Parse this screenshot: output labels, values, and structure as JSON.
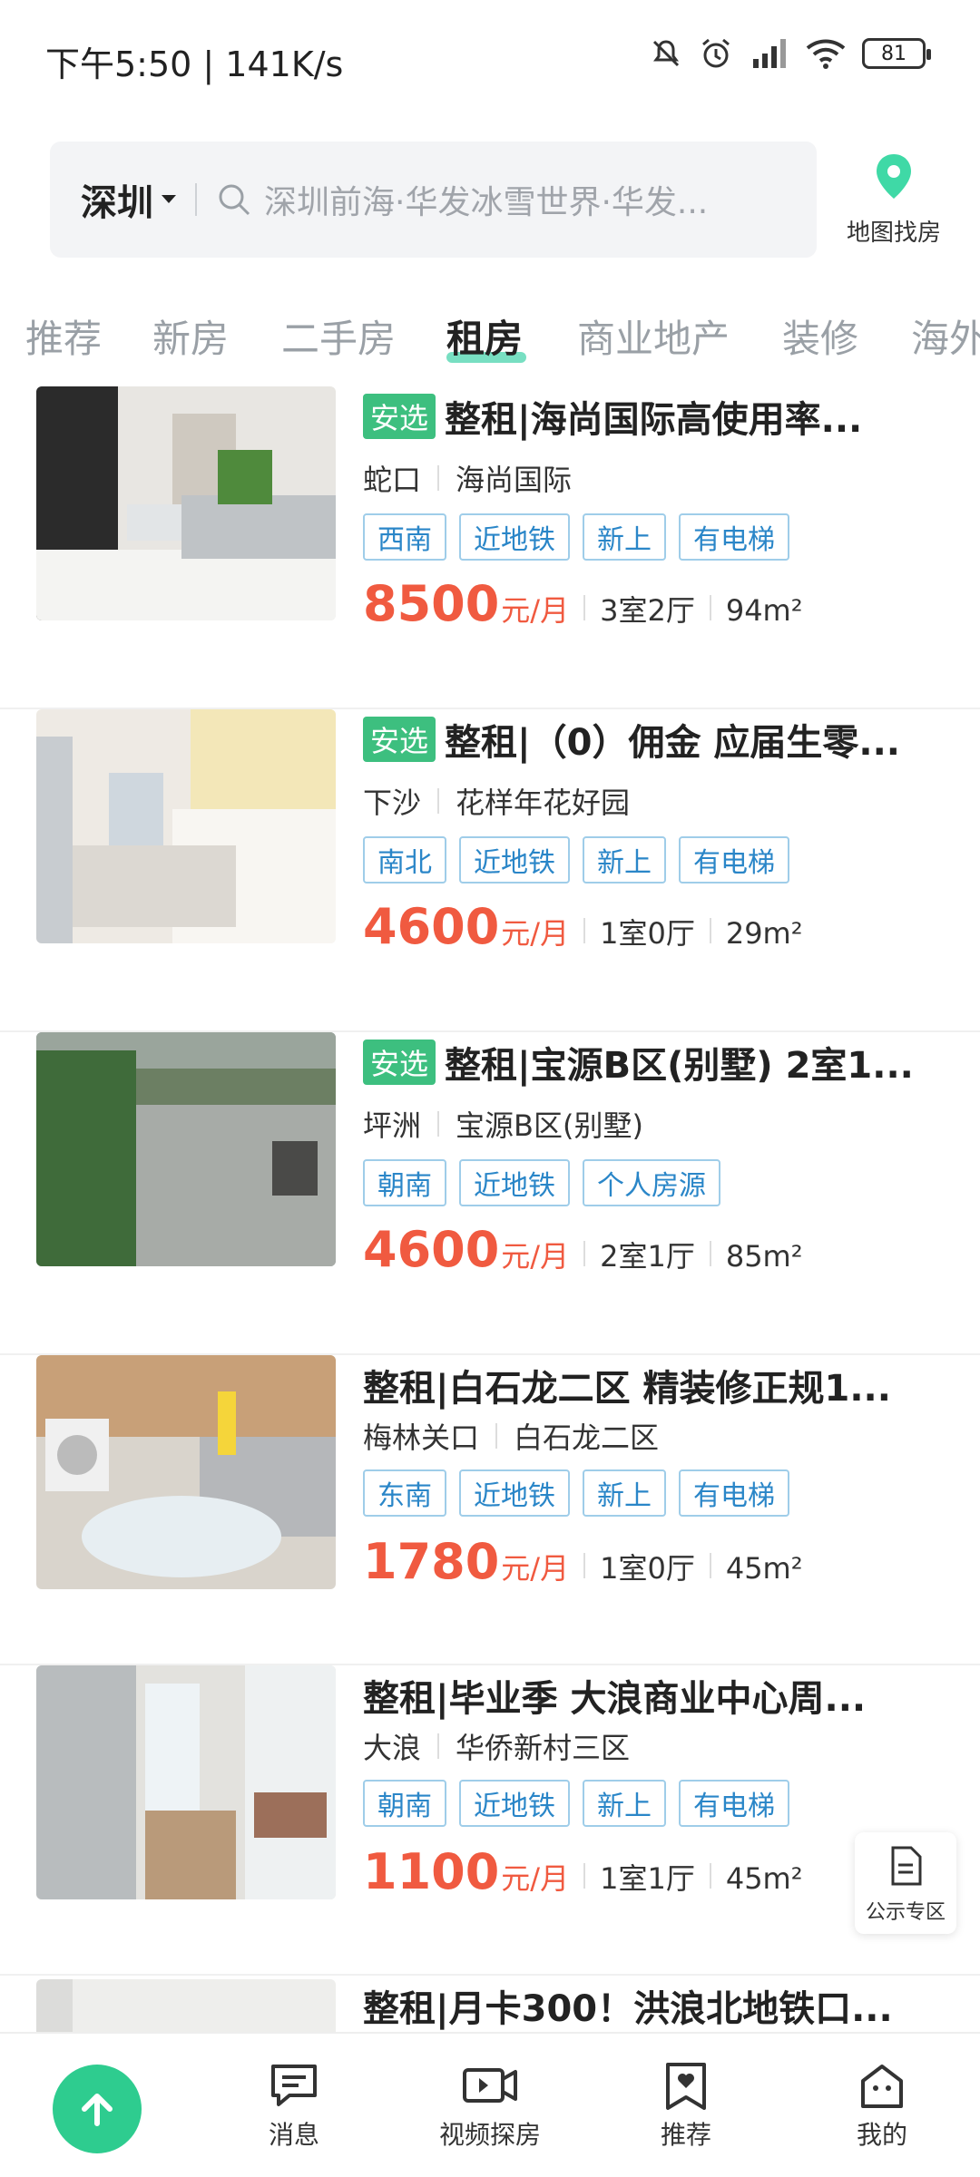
{
  "status_bar": {
    "time": "下午5:50 | 141K/s",
    "battery": "81"
  },
  "search": {
    "city": "深圳",
    "placeholder": "深圳前海·华发冰雪世界·华发..."
  },
  "map_button": {
    "label": "地图找房"
  },
  "tabs": [
    "推荐",
    "新房",
    "二手房",
    "租房",
    "商业地产",
    "装修",
    "海外"
  ],
  "active_tab": "租房",
  "listings": [
    {
      "badge": "安选",
      "title": "整租|海尚国际高使用率...",
      "area": "蛇口",
      "community": "海尚国际",
      "tags": [
        "西南",
        "近地铁",
        "新上",
        "有电梯"
      ],
      "price": "8500",
      "unit": "元/月",
      "layout": "3室2厅",
      "size": "94m²"
    },
    {
      "badge": "安选",
      "title": "整租|（0）佣金 应届生零...",
      "area": "下沙",
      "community": "花样年花好园",
      "tags": [
        "南北",
        "近地铁",
        "新上",
        "有电梯"
      ],
      "price": "4600",
      "unit": "元/月",
      "layout": "1室0厅",
      "size": "29m²"
    },
    {
      "badge": "安选",
      "title": "整租|宝源B区(别墅) 2室1...",
      "area": "坪洲",
      "community": "宝源B区(别墅)",
      "tags": [
        "朝南",
        "近地铁",
        "个人房源"
      ],
      "price": "4600",
      "unit": "元/月",
      "layout": "2室1厅",
      "size": "85m²"
    },
    {
      "badge": "",
      "title": "整租|白石龙二区 精装修正规1...",
      "area": "梅林关口",
      "community": "白石龙二区",
      "tags": [
        "东南",
        "近地铁",
        "新上",
        "有电梯"
      ],
      "price": "1780",
      "unit": "元/月",
      "layout": "1室0厅",
      "size": "45m²"
    },
    {
      "badge": "",
      "title": "整租|毕业季 大浪商业中心周...",
      "area": "大浪",
      "community": "华侨新村三区",
      "tags": [
        "朝南",
        "近地铁",
        "新上",
        "有电梯"
      ],
      "price": "1100",
      "unit": "元/月",
      "layout": "1室1厅",
      "size": "45m²"
    },
    {
      "badge": "",
      "title": "整租|月卡300！洪浪北地铁口...",
      "area": "",
      "community": "",
      "tags": [],
      "price": "",
      "unit": "",
      "layout": "",
      "size": ""
    }
  ],
  "notice": {
    "label": "公示专区"
  },
  "bottom_nav": {
    "messages": "消息",
    "video": "视频探房",
    "recommend": "推荐",
    "mine": "我的"
  },
  "colors": {
    "accent": "#2ecc8f",
    "price": "#f05a40",
    "tag": "#2a86c8",
    "badge": "#3dbf7f"
  }
}
